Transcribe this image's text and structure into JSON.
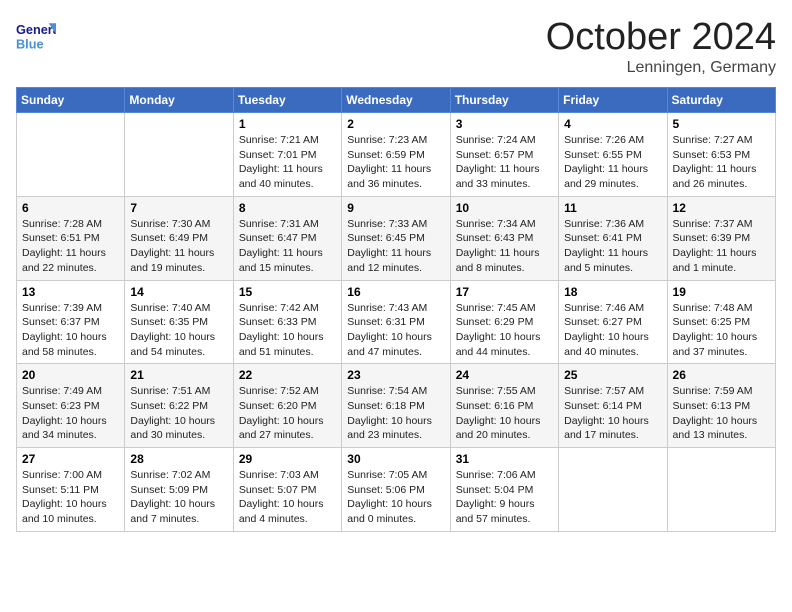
{
  "header": {
    "logo_general": "General",
    "logo_blue": "Blue",
    "month_title": "October 2024",
    "location": "Lenningen, Germany"
  },
  "weekdays": [
    "Sunday",
    "Monday",
    "Tuesday",
    "Wednesday",
    "Thursday",
    "Friday",
    "Saturday"
  ],
  "weeks": [
    [
      null,
      null,
      {
        "day": 1,
        "sunrise": "7:21 AM",
        "sunset": "7:01 PM",
        "daylight": "11 hours and 40 minutes."
      },
      {
        "day": 2,
        "sunrise": "7:23 AM",
        "sunset": "6:59 PM",
        "daylight": "11 hours and 36 minutes."
      },
      {
        "day": 3,
        "sunrise": "7:24 AM",
        "sunset": "6:57 PM",
        "daylight": "11 hours and 33 minutes."
      },
      {
        "day": 4,
        "sunrise": "7:26 AM",
        "sunset": "6:55 PM",
        "daylight": "11 hours and 29 minutes."
      },
      {
        "day": 5,
        "sunrise": "7:27 AM",
        "sunset": "6:53 PM",
        "daylight": "11 hours and 26 minutes."
      }
    ],
    [
      {
        "day": 6,
        "sunrise": "7:28 AM",
        "sunset": "6:51 PM",
        "daylight": "11 hours and 22 minutes."
      },
      {
        "day": 7,
        "sunrise": "7:30 AM",
        "sunset": "6:49 PM",
        "daylight": "11 hours and 19 minutes."
      },
      {
        "day": 8,
        "sunrise": "7:31 AM",
        "sunset": "6:47 PM",
        "daylight": "11 hours and 15 minutes."
      },
      {
        "day": 9,
        "sunrise": "7:33 AM",
        "sunset": "6:45 PM",
        "daylight": "11 hours and 12 minutes."
      },
      {
        "day": 10,
        "sunrise": "7:34 AM",
        "sunset": "6:43 PM",
        "daylight": "11 hours and 8 minutes."
      },
      {
        "day": 11,
        "sunrise": "7:36 AM",
        "sunset": "6:41 PM",
        "daylight": "11 hours and 5 minutes."
      },
      {
        "day": 12,
        "sunrise": "7:37 AM",
        "sunset": "6:39 PM",
        "daylight": "11 hours and 1 minute."
      }
    ],
    [
      {
        "day": 13,
        "sunrise": "7:39 AM",
        "sunset": "6:37 PM",
        "daylight": "10 hours and 58 minutes."
      },
      {
        "day": 14,
        "sunrise": "7:40 AM",
        "sunset": "6:35 PM",
        "daylight": "10 hours and 54 minutes."
      },
      {
        "day": 15,
        "sunrise": "7:42 AM",
        "sunset": "6:33 PM",
        "daylight": "10 hours and 51 minutes."
      },
      {
        "day": 16,
        "sunrise": "7:43 AM",
        "sunset": "6:31 PM",
        "daylight": "10 hours and 47 minutes."
      },
      {
        "day": 17,
        "sunrise": "7:45 AM",
        "sunset": "6:29 PM",
        "daylight": "10 hours and 44 minutes."
      },
      {
        "day": 18,
        "sunrise": "7:46 AM",
        "sunset": "6:27 PM",
        "daylight": "10 hours and 40 minutes."
      },
      {
        "day": 19,
        "sunrise": "7:48 AM",
        "sunset": "6:25 PM",
        "daylight": "10 hours and 37 minutes."
      }
    ],
    [
      {
        "day": 20,
        "sunrise": "7:49 AM",
        "sunset": "6:23 PM",
        "daylight": "10 hours and 34 minutes."
      },
      {
        "day": 21,
        "sunrise": "7:51 AM",
        "sunset": "6:22 PM",
        "daylight": "10 hours and 30 minutes."
      },
      {
        "day": 22,
        "sunrise": "7:52 AM",
        "sunset": "6:20 PM",
        "daylight": "10 hours and 27 minutes."
      },
      {
        "day": 23,
        "sunrise": "7:54 AM",
        "sunset": "6:18 PM",
        "daylight": "10 hours and 23 minutes."
      },
      {
        "day": 24,
        "sunrise": "7:55 AM",
        "sunset": "6:16 PM",
        "daylight": "10 hours and 20 minutes."
      },
      {
        "day": 25,
        "sunrise": "7:57 AM",
        "sunset": "6:14 PM",
        "daylight": "10 hours and 17 minutes."
      },
      {
        "day": 26,
        "sunrise": "7:59 AM",
        "sunset": "6:13 PM",
        "daylight": "10 hours and 13 minutes."
      }
    ],
    [
      {
        "day": 27,
        "sunrise": "7:00 AM",
        "sunset": "5:11 PM",
        "daylight": "10 hours and 10 minutes."
      },
      {
        "day": 28,
        "sunrise": "7:02 AM",
        "sunset": "5:09 PM",
        "daylight": "10 hours and 7 minutes."
      },
      {
        "day": 29,
        "sunrise": "7:03 AM",
        "sunset": "5:07 PM",
        "daylight": "10 hours and 4 minutes."
      },
      {
        "day": 30,
        "sunrise": "7:05 AM",
        "sunset": "5:06 PM",
        "daylight": "10 hours and 0 minutes."
      },
      {
        "day": 31,
        "sunrise": "7:06 AM",
        "sunset": "5:04 PM",
        "daylight": "9 hours and 57 minutes."
      },
      null,
      null
    ]
  ],
  "labels": {
    "sunrise": "Sunrise:",
    "sunset": "Sunset:",
    "daylight": "Daylight:"
  }
}
